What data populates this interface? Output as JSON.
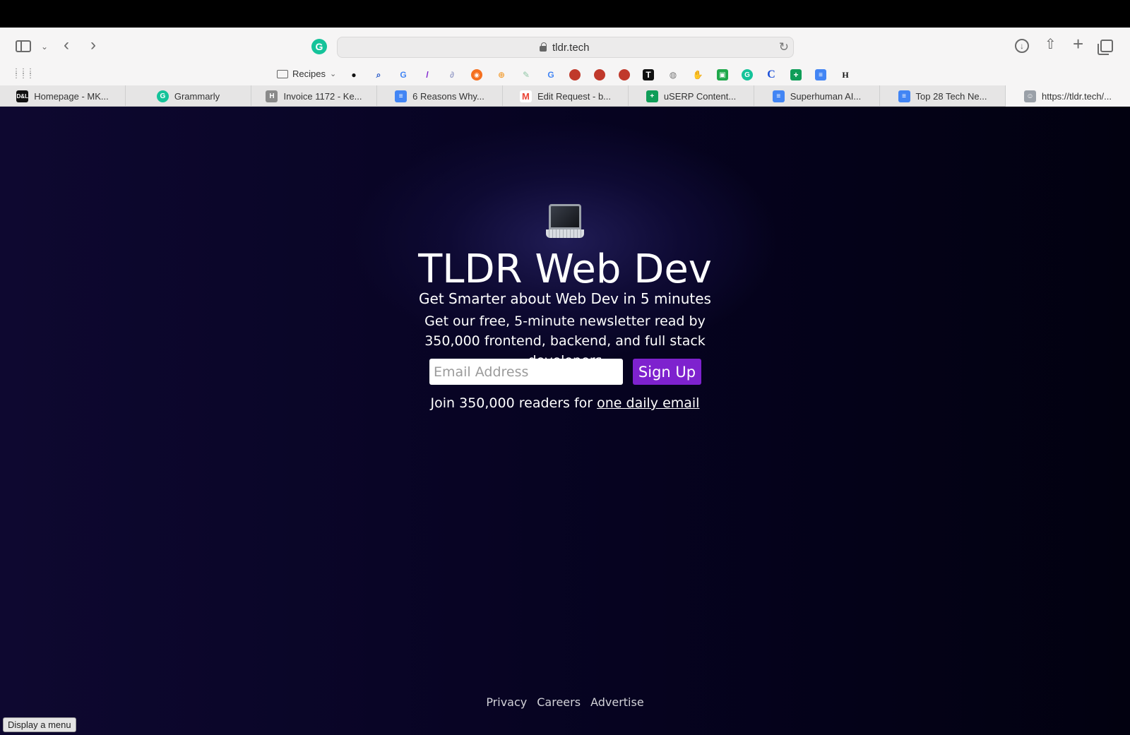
{
  "browser": {
    "address": "tldr.tech",
    "folder_label": "Recipes",
    "tabs": [
      {
        "label": "Homepage - MK...",
        "icon": "dl-logo",
        "color": "#111111"
      },
      {
        "label": "Grammarly",
        "icon": "grammarly-icon",
        "color": "#15c39a"
      },
      {
        "label": "Invoice 1172 - Ke...",
        "icon": "h-icon",
        "color": "#8a8a8a"
      },
      {
        "label": "6 Reasons Why...",
        "icon": "docs-icon",
        "color": "#4285f4"
      },
      {
        "label": "Edit Request - b...",
        "icon": "gmail-icon",
        "color": "#ea4335"
      },
      {
        "label": "uSERP Content...",
        "icon": "sheets-icon",
        "color": "#0f9d58"
      },
      {
        "label": "Superhuman AI...",
        "icon": "docs-icon",
        "color": "#4285f4"
      },
      {
        "label": "Top 28 Tech Ne...",
        "icon": "docs-icon",
        "color": "#4285f4"
      },
      {
        "label": "https://tldr.tech/...",
        "icon": "robot-icon",
        "color": "#888888"
      }
    ]
  },
  "page": {
    "title": "TLDR Web Dev",
    "subtitle": "Get Smarter about Web Dev in 5 minutes",
    "description": "Get our free, 5-minute newsletter read by 350,000 frontend, backend, and full stack developers",
    "email_placeholder": "Email Address",
    "signup_label": "Sign Up",
    "join_prefix": "Join 350,000 readers for ",
    "join_link": "one daily email",
    "accent_color": "#7e22ce"
  },
  "footer": {
    "privacy": "Privacy",
    "careers": "Careers",
    "advertise": "Advertise"
  },
  "tooltip": "Display a menu"
}
